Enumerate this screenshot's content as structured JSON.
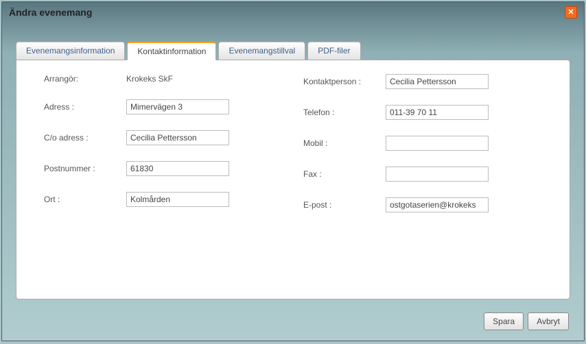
{
  "title": "Ändra evenemang",
  "tabs": {
    "info": "Evenemangsinformation",
    "contact": "Kontaktinformation",
    "options": "Evenemangstillval",
    "pdf": "PDF-filer"
  },
  "labels": {
    "organizer": "Arrangör:",
    "address": "Adress :",
    "co_address": "C/o adress :",
    "postcode": "Postnummer :",
    "city": "Ort :",
    "contact_person": "Kontaktperson :",
    "phone": "Telefon :",
    "mobile": "Mobil :",
    "fax": "Fax :",
    "email": "E-post :"
  },
  "values": {
    "organizer": "Krokeks SkF",
    "address": "Mimervägen 3",
    "co_address": "Cecilia Pettersson",
    "postcode": "61830",
    "city": "Kolmården",
    "contact_person": "Cecilia Pettersson",
    "phone": "011-39 70 11",
    "mobile": "",
    "fax": "",
    "email": "ostgotaserien@krokeks"
  },
  "buttons": {
    "save": "Spara",
    "cancel": "Avbryt"
  }
}
